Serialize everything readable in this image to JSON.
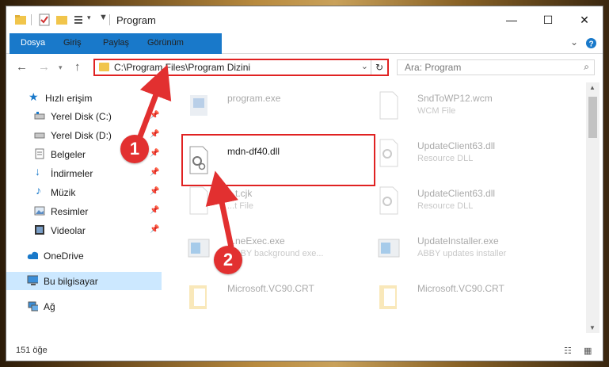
{
  "window": {
    "title": "Program",
    "controls": {
      "minimize": "—",
      "maximize": "☐",
      "close": "✕"
    }
  },
  "ribbon": {
    "tabs": [
      "Dosya",
      "Giriş",
      "Paylaş",
      "Görünüm"
    ],
    "expand_icon": "chevron-down-icon",
    "help_icon": "help-icon"
  },
  "navigation": {
    "address_path": "C:\\Program Files\\Program Dizini",
    "search_placeholder": "Ara: Program"
  },
  "sidebar": {
    "items": [
      {
        "label": "Hızlı erişim",
        "icon": "star-icon",
        "pinned": false
      },
      {
        "label": "Yerel Disk (C:)",
        "icon": "drive-icon",
        "pinned": true
      },
      {
        "label": "Yerel Disk (D:)",
        "icon": "drive-icon",
        "pinned": true
      },
      {
        "label": "Belgeler",
        "icon": "documents-icon",
        "pinned": true
      },
      {
        "label": "İndirmeler",
        "icon": "download-icon",
        "pinned": true
      },
      {
        "label": "Müzik",
        "icon": "music-icon",
        "pinned": true
      },
      {
        "label": "Resimler",
        "icon": "pictures-icon",
        "pinned": true
      },
      {
        "label": "Videolar",
        "icon": "video-icon",
        "pinned": true
      },
      {
        "label": "OneDrive",
        "icon": "cloud-icon",
        "pinned": false
      },
      {
        "label": "Bu bilgisayar",
        "icon": "computer-icon",
        "pinned": false,
        "selected": true
      },
      {
        "label": "Ağ",
        "icon": "network-icon",
        "pinned": false
      }
    ]
  },
  "files": [
    {
      "name": "program.exe",
      "type": "",
      "icon": "exe-icon",
      "faded": true
    },
    {
      "name": "SndToWP12.wcm",
      "type": "WCM File",
      "icon": "file-icon",
      "faded": true
    },
    {
      "name": "mdn-df40.dll",
      "type": "",
      "icon": "dll-icon",
      "faded": false,
      "highlighted": true
    },
    {
      "name": "UpdateClient63.dll",
      "type": "Resource DLL",
      "icon": "dll-icon",
      "faded": true
    },
    {
      "name": "...t.cjk",
      "type": "...t File",
      "icon": "file-icon",
      "faded": true
    },
    {
      "name": "UpdateClient63.dll",
      "type": "Resource DLL",
      "icon": "dll-icon",
      "faded": true
    },
    {
      "name": "...neExec.exe",
      "type": "...BBY background exe...",
      "icon": "exe-icon",
      "faded": true
    },
    {
      "name": "UpdateInstaller.exe",
      "type": "ABBY updates installer",
      "icon": "exe-icon",
      "faded": true
    },
    {
      "name": "Microsoft.VC90.CRT",
      "type": "",
      "icon": "folder-icon",
      "faded": true
    },
    {
      "name": "Microsoft.VC90.CRT",
      "type": "",
      "icon": "folder-icon",
      "faded": true
    }
  ],
  "status": {
    "item_count": "151 öğe"
  },
  "annotations": {
    "callout_1": "1",
    "callout_2": "2"
  },
  "colors": {
    "accent": "#1979ca",
    "highlight": "#e02222",
    "selection": "#cce8ff"
  }
}
